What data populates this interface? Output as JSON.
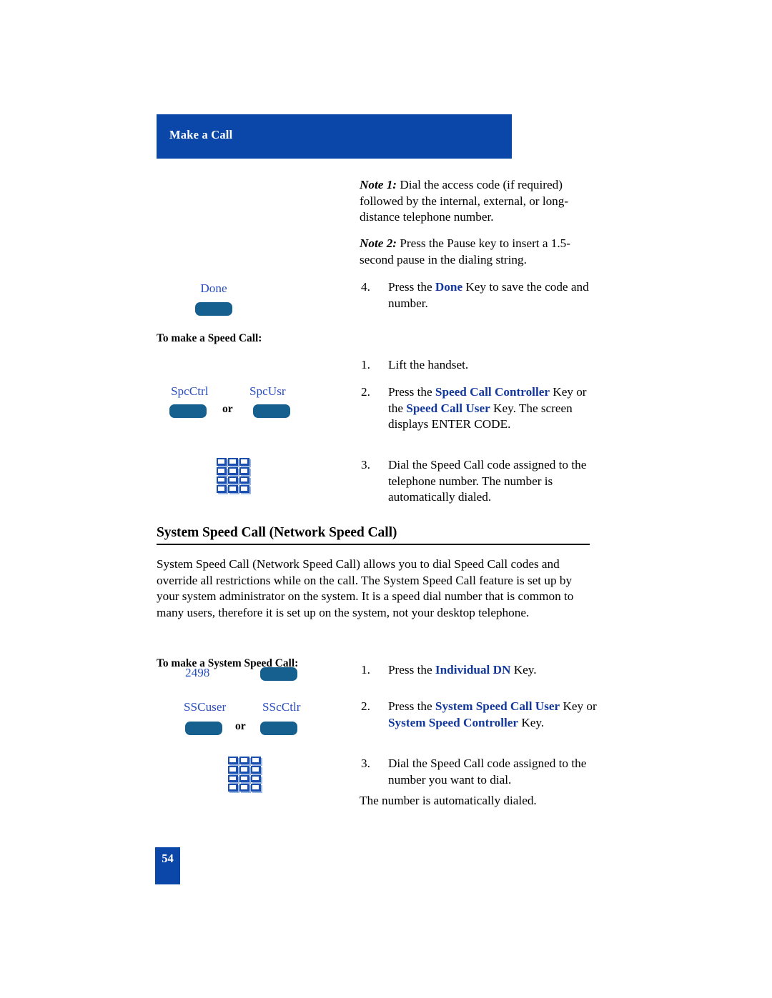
{
  "header": {
    "title": "Make a Call",
    "bar_color": "#0B47A8"
  },
  "colors": {
    "header_blue": "#0B47A8",
    "softkey_blue": "#15608F",
    "label_blue": "#2A4FBF",
    "keyword_blue": "#12389C",
    "keypad_blue": "#1A4FB0"
  },
  "notes": [
    {
      "label": "Note 1:",
      "text": "Dial the access code (if required) followed by the internal, external, or long-distance telephone number."
    },
    {
      "label": "Note 2:",
      "text": "Press the Pause key to insert a 1.5-second pause in the dialing string."
    }
  ],
  "step4": {
    "num": "4.",
    "pre": "Press the ",
    "key": "Done",
    "post": " Key to save the code and number."
  },
  "done_key": {
    "label": "Done",
    "icon": "softkey-button"
  },
  "speed_call": {
    "intro_label": "To make a Speed Call:",
    "keys": {
      "left_label": "SpcCtrl",
      "or": "or",
      "right_label": "SpcUsr",
      "keypad_icon": "dial-keypad-icon"
    },
    "steps": [
      {
        "num": "1.",
        "segments": [
          {
            "type": "plain",
            "text": "Lift the handset."
          }
        ]
      },
      {
        "num": "2.",
        "segments": [
          {
            "type": "plain",
            "text": "Press the "
          },
          {
            "type": "key",
            "text": "Speed Call Controller"
          },
          {
            "type": "plain",
            "text": " Key or the "
          },
          {
            "type": "key",
            "text": "Speed Call User"
          },
          {
            "type": "plain",
            "text": " Key. The screen displays ENTER CODE."
          }
        ]
      },
      {
        "num": "3.",
        "segments": [
          {
            "type": "plain",
            "text": "Dial the Speed Call code assigned to the telephone number. The number is automatically dialed."
          }
        ]
      }
    ]
  },
  "system_speed_call": {
    "heading": "System Speed Call (Network Speed Call)",
    "paragraph": "System Speed Call (Network Speed Call) allows you to dial Speed Call codes and override all restrictions while on the call. The System Speed Call feature is set up by your system administrator on the system. It is a speed dial number that is common to many users, therefore it is set up on the system, not your desktop telephone.",
    "intro_label": "To make a System Speed Call:",
    "keys": {
      "dn_label": "2498",
      "dn_icon": "line-key-button",
      "left_label": "SSCuser",
      "or": "or",
      "right_label": "SScCtlr",
      "keypad_icon": "dial-keypad-icon"
    },
    "steps": [
      {
        "num": "1.",
        "segments": [
          {
            "type": "plain",
            "text": "Press the "
          },
          {
            "type": "key",
            "text": "Individual DN"
          },
          {
            "type": "plain",
            "text": " Key."
          }
        ]
      },
      {
        "num": "2.",
        "segments": [
          {
            "type": "plain",
            "text": "Press the "
          },
          {
            "type": "key",
            "text": "System Speed Call User"
          },
          {
            "type": "plain",
            "text": " Key or "
          },
          {
            "type": "key",
            "text": "System Speed Controller"
          },
          {
            "type": "plain",
            "text": " Key."
          }
        ]
      },
      {
        "num": "3.",
        "segments": [
          {
            "type": "plain",
            "text": "Dial the Speed Call code assigned to the number you want to dial."
          }
        ]
      }
    ],
    "closing": "The number is automatically dialed."
  },
  "footer": {
    "page_number": "54"
  }
}
